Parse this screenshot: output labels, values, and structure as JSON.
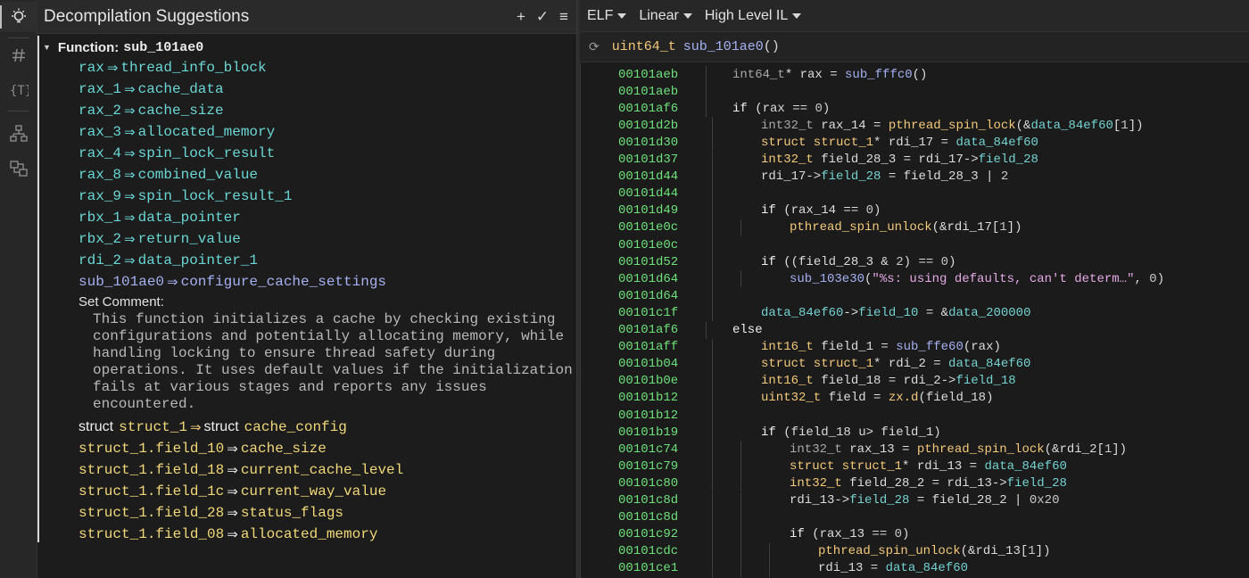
{
  "left_panel": {
    "title": "Decompilation Suggestions",
    "actions": {
      "add": "+",
      "accept": "✓",
      "menu": "≡"
    },
    "function_label": "Function:",
    "function_name": "sub_101ae0",
    "variable_suggestions": [
      {
        "from": "rax",
        "to": "thread_info_block",
        "kind": "var"
      },
      {
        "from": "rax_1",
        "to": "cache_data",
        "kind": "var"
      },
      {
        "from": "rax_2",
        "to": "cache_size",
        "kind": "var"
      },
      {
        "from": "rax_3",
        "to": "allocated_memory",
        "kind": "var"
      },
      {
        "from": "rax_4",
        "to": "spin_lock_result",
        "kind": "var"
      },
      {
        "from": "rax_8",
        "to": "combined_value",
        "kind": "var"
      },
      {
        "from": "rax_9",
        "to": "spin_lock_result_1",
        "kind": "var"
      },
      {
        "from": "rbx_1",
        "to": "data_pointer",
        "kind": "var"
      },
      {
        "from": "rbx_2",
        "to": "return_value",
        "kind": "var"
      },
      {
        "from": "rdi_2",
        "to": "data_pointer_1",
        "kind": "var"
      },
      {
        "from": "sub_101ae0",
        "to": "configure_cache_settings",
        "kind": "func"
      }
    ],
    "set_comment_label": "Set Comment:",
    "comment_text": "This function initializes a cache by checking existing configurations and potentially allocating memory, while handling locking to ensure thread safety during operations. It uses default values if the initialization fails at various stages and reports any issues encountered.",
    "struct_rename": {
      "kw": "struct",
      "from": "struct_1",
      "to": "cache_config"
    },
    "field_suggestions": [
      {
        "from": "struct_1.field_10",
        "to": "cache_size"
      },
      {
        "from": "struct_1.field_18",
        "to": "current_cache_level"
      },
      {
        "from": "struct_1.field_1c",
        "to": "current_way_value"
      },
      {
        "from": "struct_1.field_28",
        "to": "status_flags"
      },
      {
        "from": "struct_1.field_08",
        "to": "allocated_memory"
      }
    ],
    "arrow": "⇒"
  },
  "toolbar": {
    "view_type": "ELF",
    "layout": "Linear",
    "il_level": "High Level IL"
  },
  "signature": {
    "return_type": "uint64_t",
    "name": "sub_101ae0",
    "params": "()"
  },
  "code_lines": [
    {
      "addr": "00101aeb",
      "indent": 0,
      "html": "<span class='tpd'>int64_t</span>* rax = <span class='fnb'>sub_fffc0</span>()"
    },
    {
      "addr": "00101aeb",
      "indent": 0,
      "html": ""
    },
    {
      "addr": "00101af6",
      "indent": 0,
      "html": "<span class='k'>if</span> (rax == <span class='num'>0</span>)"
    },
    {
      "addr": "00101d2b",
      "indent": 1,
      "html": "<span class='tpd'>int32_t</span> rax_14 = <span class='fn'>pthread_spin_lock</span>(&amp;<span class='dt'>data_84ef60</span>[<span class='num'>1</span>])"
    },
    {
      "addr": "00101d30",
      "indent": 1,
      "html": "<span class='tp'>struct struct_1</span>* rdi_17 = <span class='dt'>data_84ef60</span>"
    },
    {
      "addr": "00101d37",
      "indent": 1,
      "html": "<span class='tp'>int32_t</span> field_28_3 = rdi_17-&gt;<span class='fld'>field_28</span>"
    },
    {
      "addr": "00101d44",
      "indent": 1,
      "html": "rdi_17-&gt;<span class='fld'>field_28</span> = field_28_3 | <span class='num'>2</span>"
    },
    {
      "addr": "00101d44",
      "indent": 1,
      "html": ""
    },
    {
      "addr": "00101d49",
      "indent": 1,
      "html": "<span class='k'>if</span> (rax_14 == <span class='num'>0</span>)"
    },
    {
      "addr": "00101e0c",
      "indent": 2,
      "html": "<span class='fn'>pthread_spin_unlock</span>(&amp;rdi_17[<span class='num'>1</span>])"
    },
    {
      "addr": "00101e0c",
      "indent": 1,
      "html": ""
    },
    {
      "addr": "00101d52",
      "indent": 1,
      "html": "<span class='k'>if</span> ((field_28_3 &amp; <span class='num'>2</span>) == <span class='num'>0</span>)"
    },
    {
      "addr": "00101d64",
      "indent": 2,
      "html": "<span class='fnb'>sub_103e30</span>(<span class='str'>\"%s: using defaults, can't determ…\"</span>, <span class='num'>0</span>)"
    },
    {
      "addr": "00101d64",
      "indent": 1,
      "html": ""
    },
    {
      "addr": "00101c1f",
      "indent": 1,
      "html": "<span class='dt'>data_84ef60</span>-&gt;<span class='fld'>field_10</span> = &amp;<span class='dt'>data_200000</span>"
    },
    {
      "addr": "00101af6",
      "indent": 0,
      "html": "<span class='k'>else</span>"
    },
    {
      "addr": "00101aff",
      "indent": 1,
      "html": "<span class='tp'>int16_t</span> field_1 = <span class='fnb'>sub_ffe60</span>(rax)"
    },
    {
      "addr": "00101b04",
      "indent": 1,
      "html": "<span class='tp'>struct struct_1</span>* rdi_2 = <span class='dt'>data_84ef60</span>"
    },
    {
      "addr": "00101b0e",
      "indent": 1,
      "html": "<span class='tp'>int16_t</span> field_18 = rdi_2-&gt;<span class='fld'>field_18</span>"
    },
    {
      "addr": "00101b12",
      "indent": 1,
      "html": "<span class='tp'>uint32_t</span> field = <span class='zx'>zx.d</span>(field_18)"
    },
    {
      "addr": "00101b12",
      "indent": 1,
      "html": ""
    },
    {
      "addr": "00101b19",
      "indent": 1,
      "html": "<span class='k'>if</span> (field_18 u&gt; field_1)"
    },
    {
      "addr": "00101c74",
      "indent": 2,
      "html": "<span class='tpd'>int32_t</span> rax_13 = <span class='fn'>pthread_spin_lock</span>(&amp;rdi_2[<span class='num'>1</span>])"
    },
    {
      "addr": "00101c79",
      "indent": 2,
      "html": "<span class='tp'>struct struct_1</span>* rdi_13 = <span class='dt'>data_84ef60</span>"
    },
    {
      "addr": "00101c80",
      "indent": 2,
      "html": "<span class='tp'>int32_t</span> field_28_2 = rdi_13-&gt;<span class='fld'>field_28</span>"
    },
    {
      "addr": "00101c8d",
      "indent": 2,
      "html": "rdi_13-&gt;<span class='fld'>field_28</span> = field_28_2 | <span class='num'>0x20</span>"
    },
    {
      "addr": "00101c8d",
      "indent": 2,
      "html": ""
    },
    {
      "addr": "00101c92",
      "indent": 2,
      "html": "<span class='k'>if</span> (rax_13 == <span class='num'>0</span>)"
    },
    {
      "addr": "00101cdc",
      "indent": 3,
      "html": "<span class='fn'>pthread_spin_unlock</span>(&amp;rdi_13[<span class='num'>1</span>])"
    },
    {
      "addr": "00101ce1",
      "indent": 3,
      "html": "rdi_13 = <span class='dt'>data_84ef60</span>"
    }
  ]
}
